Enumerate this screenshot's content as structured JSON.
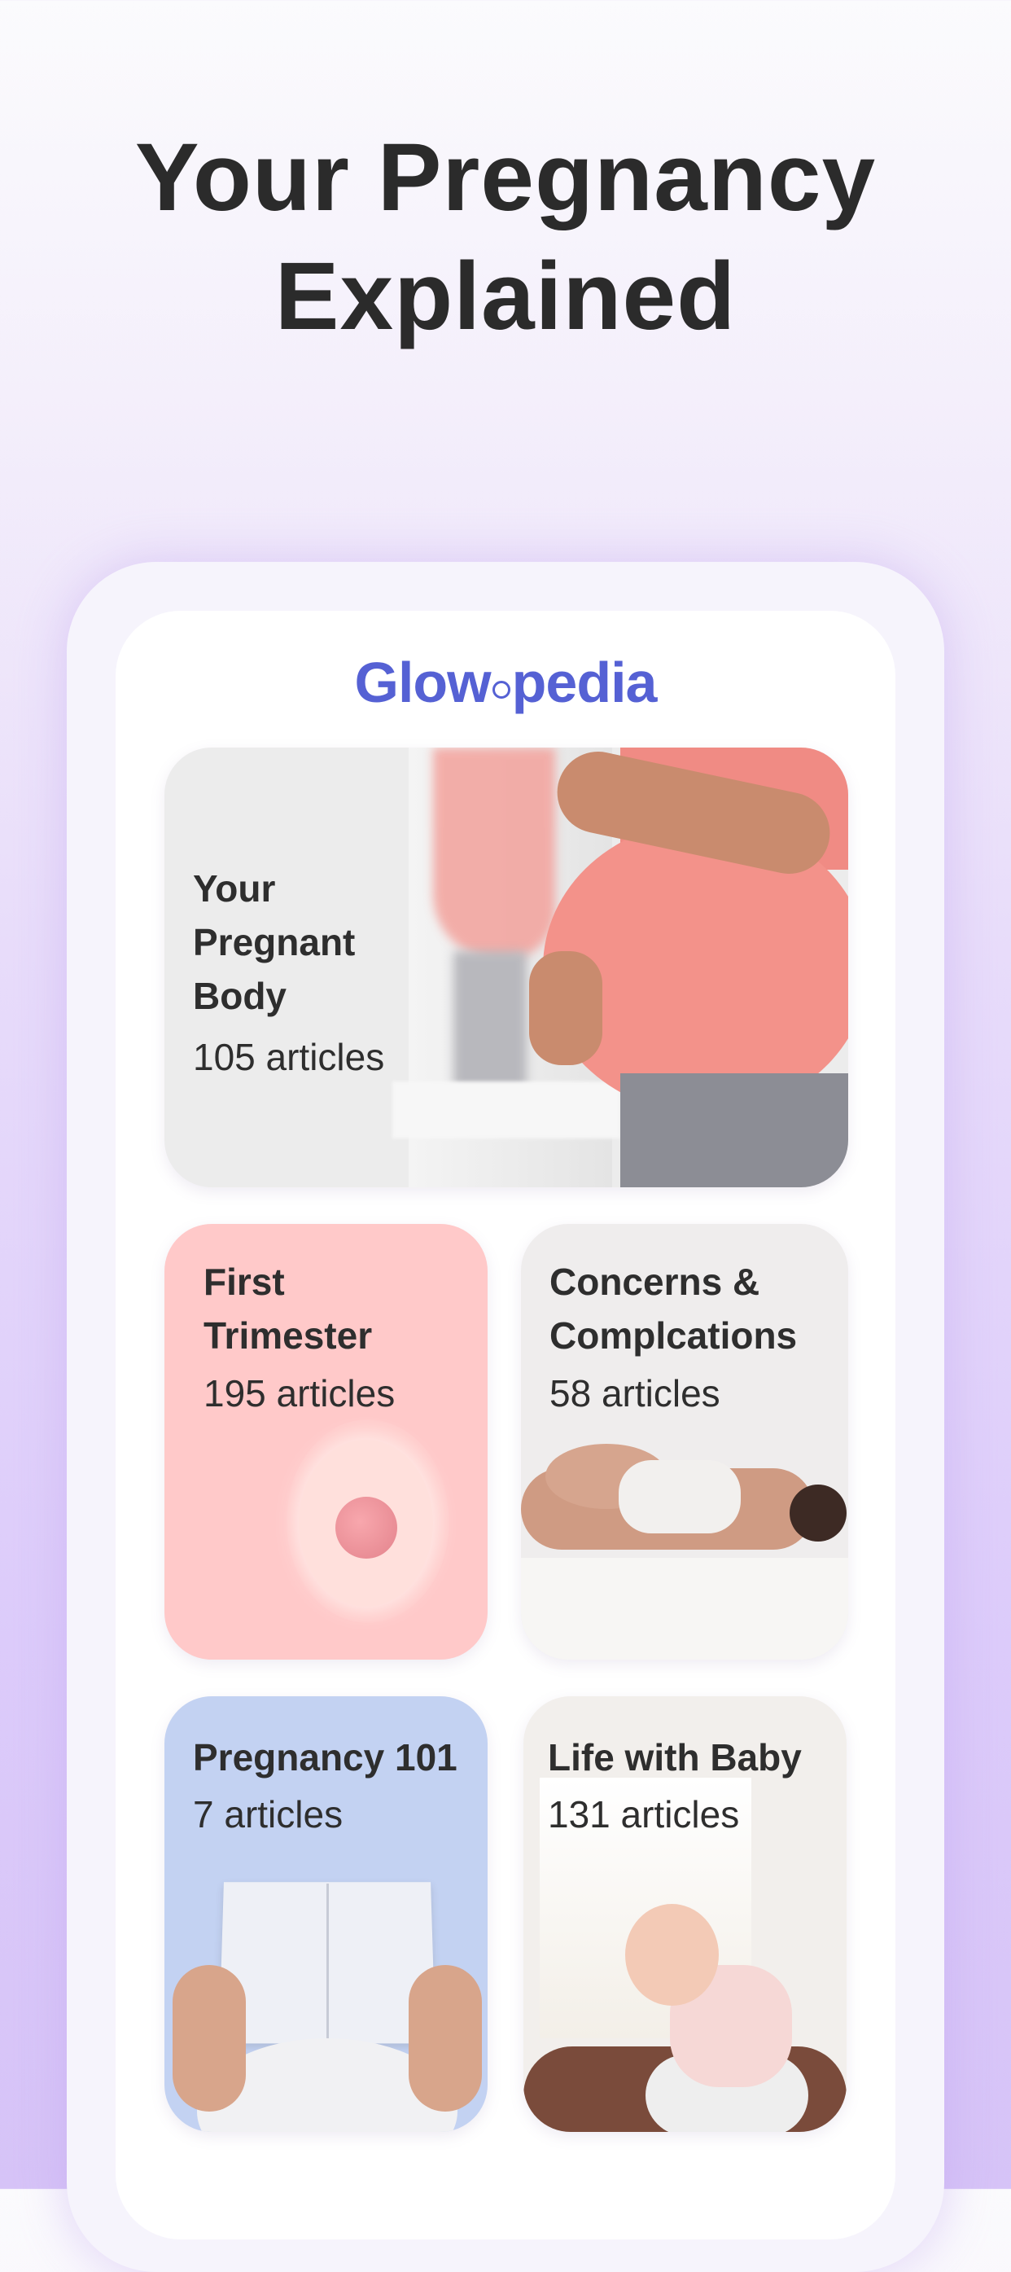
{
  "headline": {
    "line1": "Your Pregnancy",
    "line2": "Explained"
  },
  "app": {
    "logo_part1": "Glow",
    "logo_part2": "pedia",
    "brand_color": "#5561d4"
  },
  "categories": [
    {
      "title": "Your\nPregnant\nBody",
      "count": "105 articles",
      "background": "#ececec"
    },
    {
      "title": "First\nTrimester",
      "count": "195 articles",
      "background": "#ffc9c9"
    },
    {
      "title": "Concerns &\nComplcations",
      "count": "58 articles",
      "background": "#efeded"
    },
    {
      "title": "Pregnancy 101",
      "count": "7 articles",
      "background": "#c3d2f2"
    },
    {
      "title": "Life with Baby",
      "count": "131 articles",
      "background": "#f2efec"
    }
  ]
}
